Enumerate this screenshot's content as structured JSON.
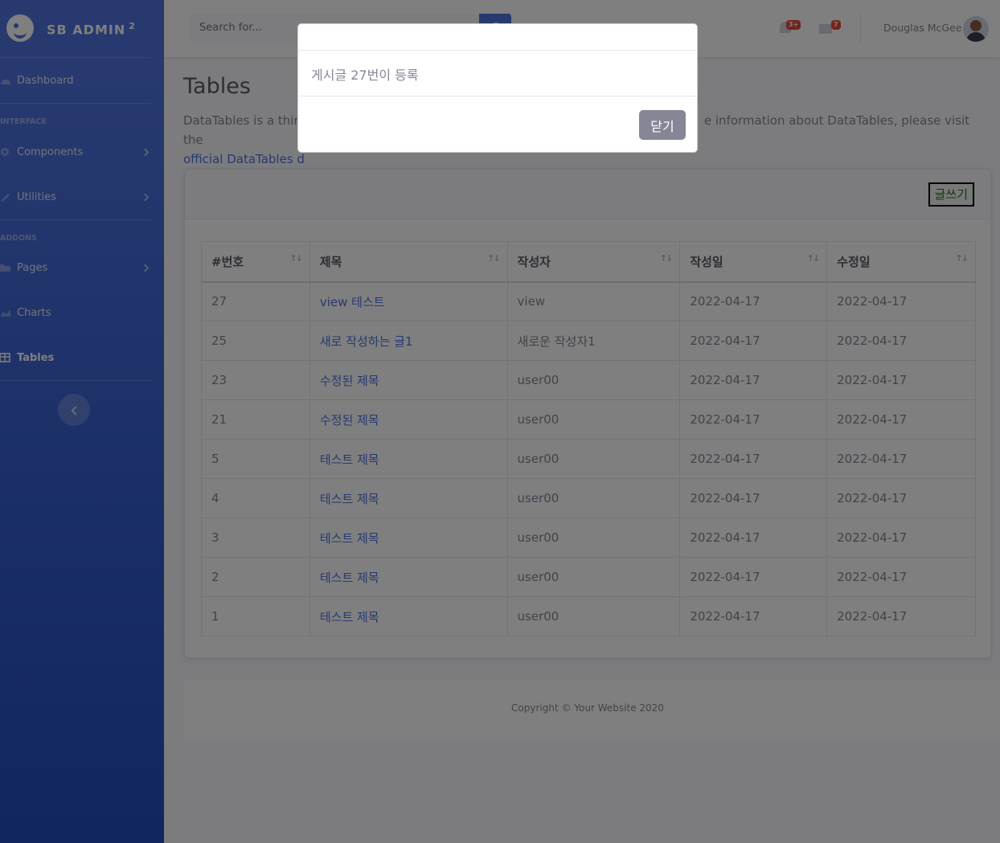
{
  "sidebar": {
    "brand": "SB ADMIN",
    "brand_sup": "2",
    "dashboard": "Dashboard",
    "heading_interface": "INTERFACE",
    "components": "Components",
    "utilities": "Utilities",
    "heading_addons": "ADDONS",
    "pages": "Pages",
    "charts": "Charts",
    "tables": "Tables"
  },
  "topbar": {
    "search_placeholder": "Search for...",
    "alerts_badge": "3+",
    "messages_badge": "7",
    "username": "Douglas McGee"
  },
  "main": {
    "title": "Tables",
    "desc_start": "DataTables is a third",
    "desc_end": "e information about DataTables, please visit the",
    "desc_link": "official DataTables d",
    "write_button": "글쓰기",
    "table": {
      "headers": [
        "#번호",
        "제목",
        "작성자",
        "작성일",
        "수정일"
      ],
      "rows": [
        [
          "27",
          "view 테스트",
          "view",
          "2022-04-17",
          "2022-04-17"
        ],
        [
          "25",
          "새로 작성하는 글1",
          "새로운 작성자1",
          "2022-04-17",
          "2022-04-17"
        ],
        [
          "23",
          "수정된 제목",
          "user00",
          "2022-04-17",
          "2022-04-17"
        ],
        [
          "21",
          "수정된 제목",
          "user00",
          "2022-04-17",
          "2022-04-17"
        ],
        [
          "5",
          "테스트 제목",
          "user00",
          "2022-04-17",
          "2022-04-17"
        ],
        [
          "4",
          "테스트 제목",
          "user00",
          "2022-04-17",
          "2022-04-17"
        ],
        [
          "3",
          "테스트 제목",
          "user00",
          "2022-04-17",
          "2022-04-17"
        ],
        [
          "2",
          "테스트 제목",
          "user00",
          "2022-04-17",
          "2022-04-17"
        ],
        [
          "1",
          "테스트 제목",
          "user00",
          "2022-04-17",
          "2022-04-17"
        ]
      ]
    }
  },
  "footer": {
    "text": "Copyright © Your Website 2020"
  },
  "modal": {
    "body": "게시글 27번이 등록",
    "close_button": "닫기"
  }
}
